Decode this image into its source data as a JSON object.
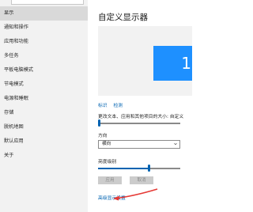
{
  "sidebar": {
    "items": [
      {
        "label": "显示",
        "active": true
      },
      {
        "label": "通知和操作"
      },
      {
        "label": "应用和功能"
      },
      {
        "label": "多任务"
      },
      {
        "label": "平板电脑模式"
      },
      {
        "label": "节电模式"
      },
      {
        "label": "电源和睡眠"
      },
      {
        "label": "存储"
      },
      {
        "label": "脱机地图"
      },
      {
        "label": "默认应用"
      },
      {
        "label": "关于"
      }
    ]
  },
  "main": {
    "title": "自定义显示器",
    "monitor_number": "1",
    "links": {
      "identify": "标识",
      "detect": "检测"
    },
    "scale_label": "更改文本、应用和其他项目的大小: 自定义",
    "scale_slider_value": 0.0,
    "orientation_label": "方向",
    "orientation_value": "横向",
    "brightness_label": "亮度级别",
    "brightness_slider_value": 0.62,
    "apply_button": "应用",
    "cancel_button": "取消",
    "advanced_link": "高级显示设置"
  },
  "colors": {
    "accent": "#0063b1",
    "monitor": "#1e90ff",
    "sidebar_bg": "#f2f2f2",
    "annotation": "#e53935"
  }
}
